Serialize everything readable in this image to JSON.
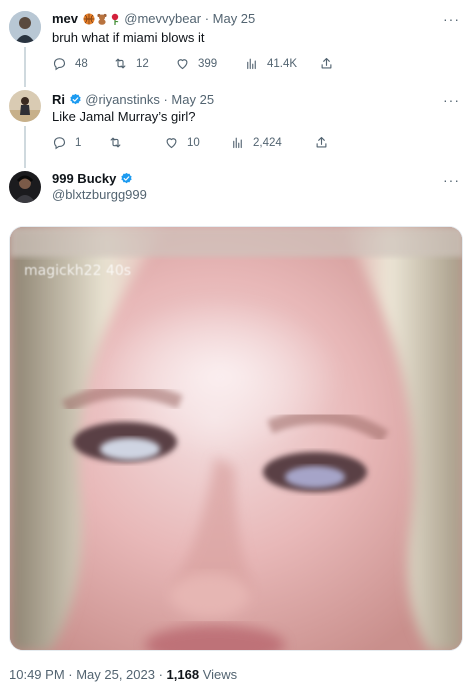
{
  "tweets": [
    {
      "name": "mev",
      "handle": "@mevvybear",
      "date": "· May 25",
      "text": "bruh what if miami blows it",
      "replies": "48",
      "retweets": "12",
      "likes": "399",
      "views": "41.4K",
      "emoji": [
        "basketball",
        "teddy-bear",
        "rose"
      ]
    },
    {
      "name": "Ri",
      "handle": "@riyanstinks",
      "date": "· May 25",
      "text": "Like Jamal Murray’s girl?",
      "replies": "1",
      "retweets": "",
      "likes": "10",
      "views": "2,424"
    },
    {
      "name": "999 Bucky",
      "handle": "@blxtzburgg999"
    }
  ],
  "media": {
    "overlay_text": "magickh22 40s"
  },
  "footer": {
    "time": "10:49 PM · May 25, 2023 · ",
    "views_count": "1,168",
    "views_label": " Views"
  },
  "colors": {
    "verified_blue": "#1d9bf0",
    "secondary_text": "#536471",
    "thread_line": "#cfd9de"
  },
  "icons": [
    "more-icon",
    "reply-icon",
    "retweet-icon",
    "like-icon",
    "views-icon",
    "share-icon",
    "verified-badge-icon"
  ]
}
